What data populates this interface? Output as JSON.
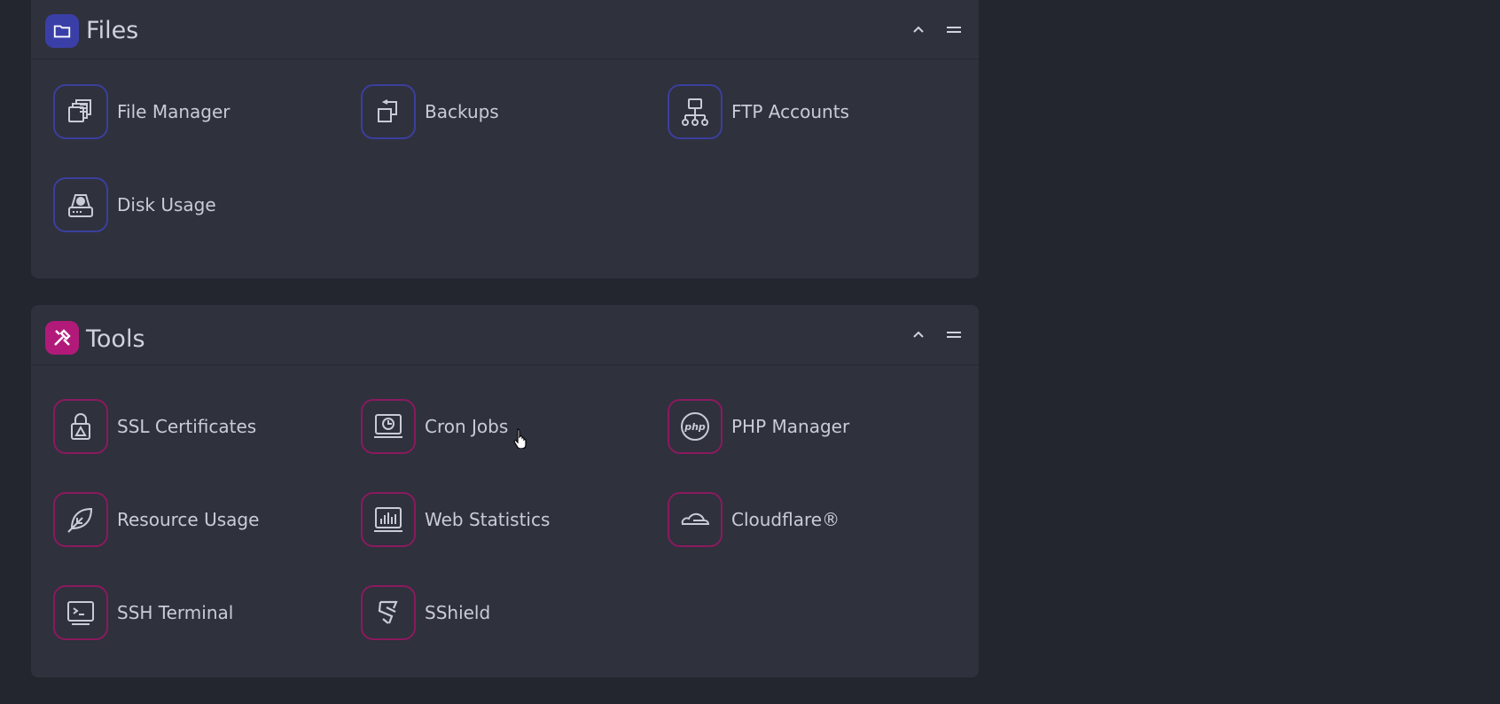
{
  "files": {
    "title": "Files",
    "icon": "folder-icon",
    "accent": "#3a3fa8",
    "items": [
      {
        "label": "File Manager",
        "icon": "file-manager-icon"
      },
      {
        "label": "Backups",
        "icon": "backups-icon"
      },
      {
        "label": "FTP Accounts",
        "icon": "ftp-network-icon"
      },
      {
        "label": "Disk Usage",
        "icon": "disk-usage-icon"
      }
    ]
  },
  "tools": {
    "title": "Tools",
    "icon": "tools-icon",
    "accent": "#b21a7a",
    "items": [
      {
        "label": "SSL Certificates",
        "icon": "lock-icon"
      },
      {
        "label": "Cron Jobs",
        "icon": "clock-monitor-icon"
      },
      {
        "label": "PHP Manager",
        "icon": "php-icon"
      },
      {
        "label": "Resource Usage",
        "icon": "leaf-icon"
      },
      {
        "label": "Web Statistics",
        "icon": "bar-chart-icon"
      },
      {
        "label": "Cloudflare®",
        "icon": "cloud-icon"
      },
      {
        "label": "SSH Terminal",
        "icon": "terminal-icon"
      },
      {
        "label": "SShield",
        "icon": "shield-icon"
      }
    ]
  }
}
